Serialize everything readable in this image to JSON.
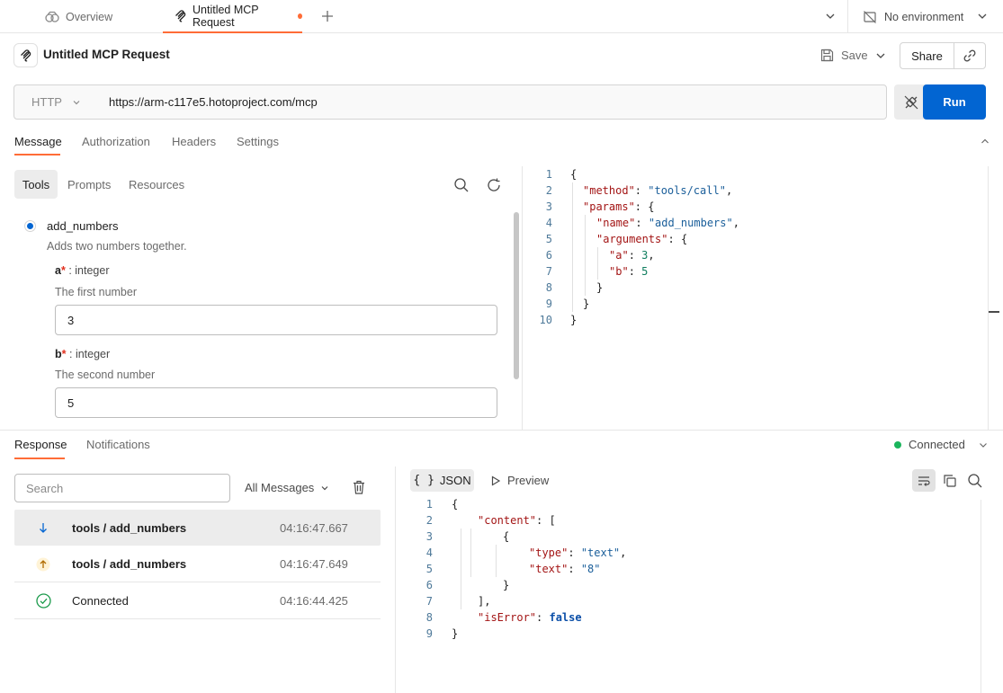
{
  "tabs": {
    "overview_label": "Overview",
    "request_label": "Untitled MCP Request"
  },
  "environment": {
    "label": "No environment"
  },
  "request": {
    "title": "Untitled MCP Request",
    "save_label": "Save",
    "share_label": "Share",
    "method": "HTTP",
    "url": "https://arm-c117e5.hotoproject.com/mcp",
    "run_label": "Run",
    "tabs": [
      "Message",
      "Authorization",
      "Headers",
      "Settings"
    ]
  },
  "tools_panel": {
    "tabs": [
      "Tools",
      "Prompts",
      "Resources"
    ],
    "tool": {
      "name": "add_numbers",
      "description": "Adds two numbers together.",
      "params": [
        {
          "name": "a",
          "required_mark": "*",
          "type": ": integer",
          "description": "The first number",
          "value": "3"
        },
        {
          "name": "b",
          "required_mark": "*",
          "type": ": integer",
          "description": "The second number",
          "value": "5"
        }
      ]
    }
  },
  "editor": {
    "line_numbers": [
      "1",
      "2",
      "3",
      "4",
      "5",
      "6",
      "7",
      "8",
      "9",
      "10"
    ],
    "tokens": {
      "open": "{",
      "method_key": "\"method\"",
      "method_val": "\"tools/call\"",
      "params_key": "\"params\"",
      "name_key": "\"name\"",
      "name_val": "\"add_numbers\"",
      "arguments_key": "\"arguments\"",
      "a_key": "\"a\"",
      "a_val": "3",
      "b_key": "\"b\"",
      "b_val": "5",
      "close": "}"
    }
  },
  "response": {
    "tabs": [
      "Response",
      "Notifications"
    ],
    "status": "Connected",
    "search_placeholder": "Search",
    "filter_label": "All Messages",
    "messages": [
      {
        "direction": "incoming",
        "label": "tools / add_numbers",
        "time": "04:16:47.667"
      },
      {
        "direction": "outgoing",
        "label": "tools / add_numbers",
        "time": "04:16:47.649"
      },
      {
        "direction": "status",
        "label": "Connected",
        "time": "04:16:44.425"
      }
    ],
    "view_tabs": {
      "json": "JSON",
      "json_glyph": "{ }",
      "preview": "Preview"
    },
    "body": {
      "line_numbers": [
        "1",
        "2",
        "3",
        "4",
        "5",
        "6",
        "7",
        "8",
        "9"
      ],
      "content_key": "\"content\"",
      "type_key": "\"type\"",
      "type_val": "\"text\"",
      "text_key": "\"text\"",
      "text_val": "\"8\"",
      "iserror_key": "\"isError\"",
      "iserror_val": "false"
    }
  },
  "colors": {
    "accent": "#ff6c37",
    "primary": "#0265d2",
    "connected": "#1bb55c"
  }
}
